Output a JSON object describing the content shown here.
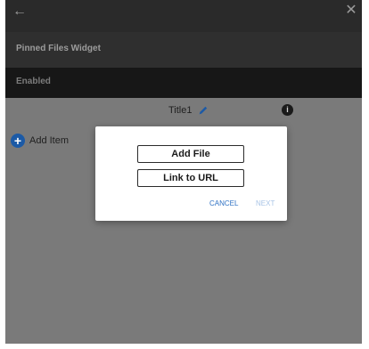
{
  "app_bar": {
    "back_icon": "arrow-left-icon",
    "close_icon": "close-icon"
  },
  "header": {
    "widget_type": "Pinned Files Widget",
    "status": "Enabled"
  },
  "content": {
    "widget_title": "Title1",
    "edit_icon": "pencil-icon",
    "info_icon": "info-icon",
    "info_glyph": "i",
    "add_item": {
      "icon": "plus-circle-icon",
      "plus_glyph": "+",
      "label": "Add Item"
    }
  },
  "dialog": {
    "add_file_label": "Add File",
    "link_url_label": "Link to URL",
    "cancel_label": "CANCEL",
    "next_label": "NEXT"
  },
  "colors": {
    "accent_blue": "#2f72c4",
    "disabled_blue": "#a9c4e6",
    "overlay_gray": "#7a7a7a",
    "dark_bar": "#2a2a2a"
  }
}
